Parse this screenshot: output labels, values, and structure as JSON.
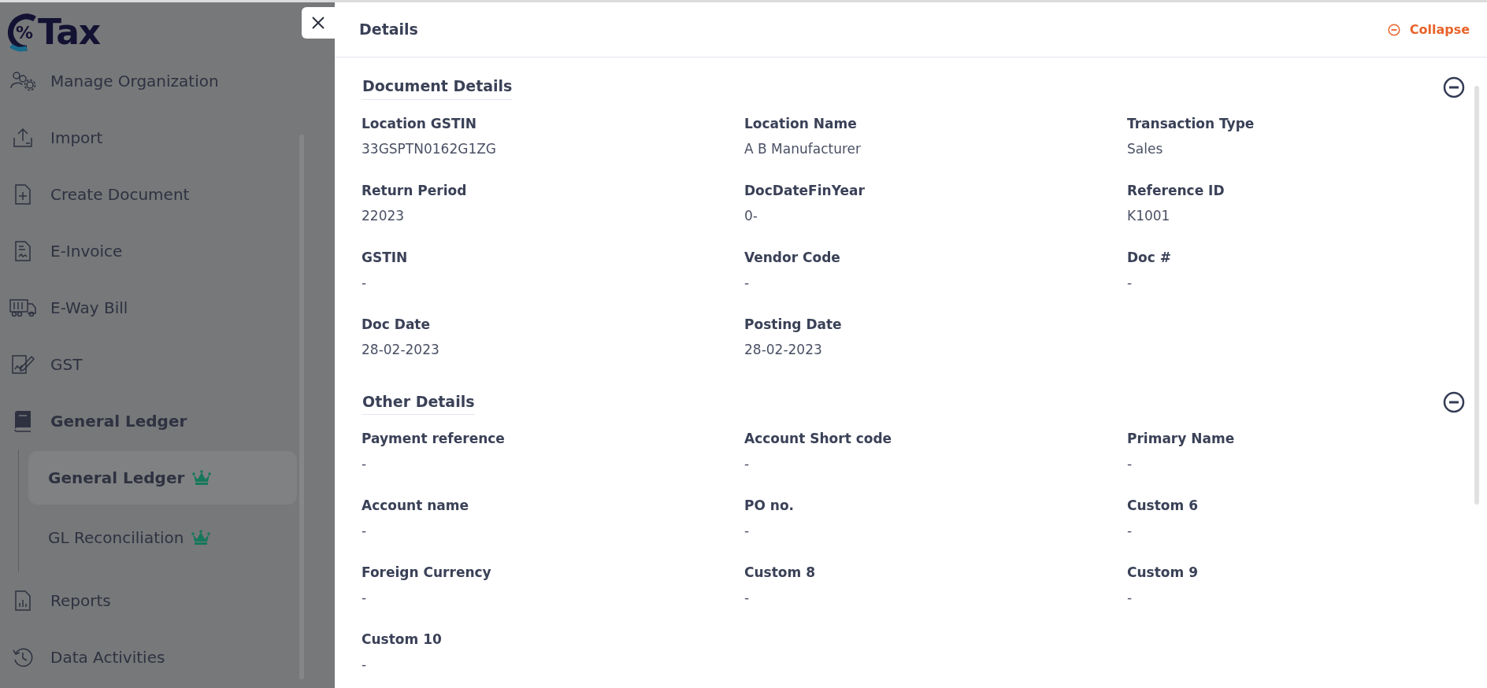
{
  "logo": {
    "mark": "%",
    "text": "Tax"
  },
  "sidebar": {
    "items": [
      {
        "label": "Manage Organization",
        "selected": false
      },
      {
        "label": "Import",
        "selected": false
      },
      {
        "label": "Create Document",
        "selected": false
      },
      {
        "label": "E-Invoice",
        "selected": false
      },
      {
        "label": "E-Way Bill",
        "selected": false
      },
      {
        "label": "GST",
        "selected": false
      },
      {
        "label": "General Ledger",
        "selected": true,
        "expanded": true,
        "children": [
          {
            "label": "General Ledger",
            "selected": true,
            "premium": true
          },
          {
            "label": "GL Reconciliation",
            "selected": false,
            "premium": true
          }
        ]
      },
      {
        "label": "Reports",
        "selected": false
      },
      {
        "label": "Data Activities",
        "selected": false
      }
    ]
  },
  "panel": {
    "title": "Details",
    "collapse_label": "Collapse",
    "sections": [
      {
        "title": "Document Details",
        "expanded": true,
        "fields": [
          {
            "label": "Location GSTIN",
            "value": "33GSPTN0162G1ZG"
          },
          {
            "label": "Location Name",
            "value": "A B Manufacturer"
          },
          {
            "label": "Transaction Type",
            "value": "Sales"
          },
          {
            "label": "Return Period",
            "value": "22023"
          },
          {
            "label": "DocDateFinYear",
            "value": "0-"
          },
          {
            "label": "Reference ID",
            "value": "K1001"
          },
          {
            "label": "GSTIN",
            "value": "-"
          },
          {
            "label": "Vendor Code",
            "value": "-"
          },
          {
            "label": "Doc #",
            "value": "-"
          },
          {
            "label": "Doc Date",
            "value": "28-02-2023"
          },
          {
            "label": "Posting Date",
            "value": "28-02-2023"
          }
        ]
      },
      {
        "title": "Other Details",
        "expanded": true,
        "fields": [
          {
            "label": "Payment reference",
            "value": "-"
          },
          {
            "label": "Account Short code",
            "value": "-"
          },
          {
            "label": "Primary Name",
            "value": "-"
          },
          {
            "label": "Account name",
            "value": "-"
          },
          {
            "label": "PO no.",
            "value": "-"
          },
          {
            "label": "Custom 6",
            "value": "-"
          },
          {
            "label": "Foreign Currency",
            "value": "-"
          },
          {
            "label": "Custom 8",
            "value": "-"
          },
          {
            "label": "Custom 9",
            "value": "-"
          },
          {
            "label": "Custom 10",
            "value": "-"
          }
        ]
      }
    ]
  }
}
